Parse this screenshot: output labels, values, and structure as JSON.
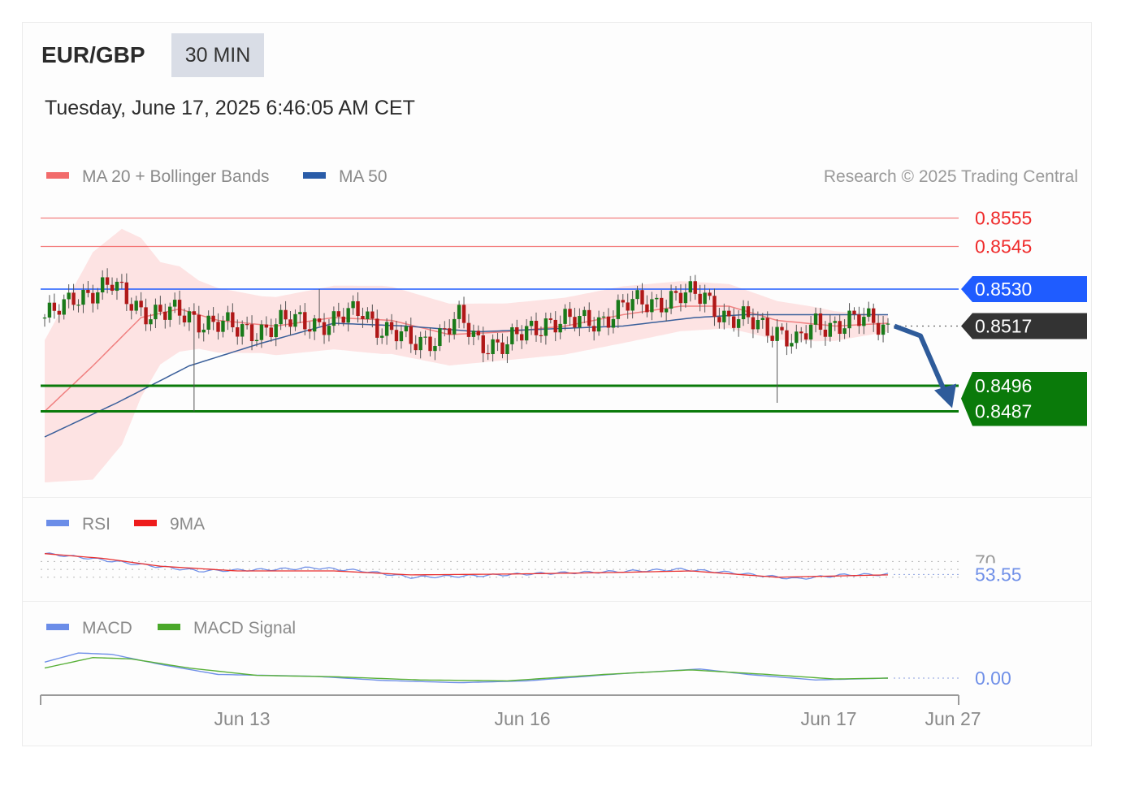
{
  "header": {
    "symbol": "EUR/GBP",
    "timeframe": "30 MIN",
    "datetime": "Tuesday, June 17, 2025 6:46:05 AM CET"
  },
  "legend_main": {
    "ma20_label": "MA 20 + Bollinger Bands",
    "ma50_label": "MA 50",
    "credit": "Research © 2025 Trading Central"
  },
  "legend_rsi": {
    "rsi_label": "RSI",
    "ma_label": "9MA"
  },
  "legend_macd": {
    "macd_label": "MACD",
    "signal_label": "MACD Signal"
  },
  "colors": {
    "resistance": "#ef2b2b",
    "pivot": "#1f5cff",
    "support": "#0a7a0a",
    "last": "#333333",
    "ma20": "#f08080",
    "ma50": "#3a5f9a",
    "band": "#fde0e0",
    "up_candle": "#1a7a1a",
    "down_candle": "#b01818",
    "arrow": "#2e5b9a",
    "rsi": "#7090e8",
    "rsi_ma": "#e83030",
    "macd": "#7090e8",
    "macd_signal": "#58b038"
  },
  "chart_data": [
    {
      "type": "candlestick",
      "instrument": "EUR/GBP",
      "interval": "30 MIN",
      "x_ticks": [
        "Jun 13",
        "Jun 16",
        "Jun 17",
        "Jun 27"
      ],
      "price_levels": [
        {
          "role": "resistance",
          "label": "0.8555",
          "value": 0.8555
        },
        {
          "role": "resistance",
          "label": "0.8545",
          "value": 0.8545
        },
        {
          "role": "pivot",
          "label": "0.8530",
          "value": 0.853
        },
        {
          "role": "last",
          "label": "0.8517",
          "value": 0.8517
        },
        {
          "role": "support",
          "label": "0.8496",
          "value": 0.8496
        },
        {
          "role": "support",
          "label": "0.8487",
          "value": 0.8487
        }
      ],
      "ylim": [
        0.8456,
        0.8566
      ],
      "forecast": "down",
      "candle_count": 176,
      "close_path": [
        {
          "i": 0,
          "v": 0.852
        },
        {
          "i": 4,
          "v": 0.8523
        },
        {
          "i": 6,
          "v": 0.8527
        },
        {
          "i": 10,
          "v": 0.853
        },
        {
          "i": 14,
          "v": 0.8531
        },
        {
          "i": 17,
          "v": 0.8526
        },
        {
          "i": 22,
          "v": 0.8522
        },
        {
          "i": 27,
          "v": 0.8521
        },
        {
          "i": 31,
          "v": 0.852
        },
        {
          "i": 36,
          "v": 0.8518
        },
        {
          "i": 40,
          "v": 0.8515
        },
        {
          "i": 44,
          "v": 0.8516
        },
        {
          "i": 50,
          "v": 0.8518
        },
        {
          "i": 55,
          "v": 0.8519
        },
        {
          "i": 60,
          "v": 0.8518
        },
        {
          "i": 66,
          "v": 0.8523
        },
        {
          "i": 70,
          "v": 0.8516
        },
        {
          "i": 76,
          "v": 0.8511
        },
        {
          "i": 82,
          "v": 0.8514
        },
        {
          "i": 86,
          "v": 0.8519
        },
        {
          "i": 90,
          "v": 0.8512
        },
        {
          "i": 96,
          "v": 0.851
        },
        {
          "i": 100,
          "v": 0.8515
        },
        {
          "i": 104,
          "v": 0.8519
        },
        {
          "i": 110,
          "v": 0.8518
        },
        {
          "i": 116,
          "v": 0.852
        },
        {
          "i": 121,
          "v": 0.8524
        },
        {
          "i": 126,
          "v": 0.8526
        },
        {
          "i": 132,
          "v": 0.8527
        },
        {
          "i": 137,
          "v": 0.8528
        },
        {
          "i": 142,
          "v": 0.8519
        },
        {
          "i": 148,
          "v": 0.8518
        },
        {
          "i": 152,
          "v": 0.8516
        },
        {
          "i": 156,
          "v": 0.851
        },
        {
          "i": 160,
          "v": 0.8518
        },
        {
          "i": 166,
          "v": 0.8518
        },
        {
          "i": 172,
          "v": 0.8519
        },
        {
          "i": 175,
          "v": 0.8517
        }
      ],
      "spikes": [
        {
          "i": 31,
          "low": 0.8487,
          "high": 0.8521
        },
        {
          "i": 57,
          "low": 0.8519,
          "high": 0.853
        },
        {
          "i": 130,
          "low": 0.8522,
          "high": 0.8531
        },
        {
          "i": 152,
          "low": 0.849,
          "high": 0.8517
        }
      ],
      "ma20": [
        {
          "i": 0,
          "v": 0.8487
        },
        {
          "i": 10,
          "v": 0.8503
        },
        {
          "i": 20,
          "v": 0.852
        },
        {
          "i": 28,
          "v": 0.8523
        },
        {
          "i": 36,
          "v": 0.8519
        },
        {
          "i": 48,
          "v": 0.8517
        },
        {
          "i": 60,
          "v": 0.852
        },
        {
          "i": 72,
          "v": 0.8519
        },
        {
          "i": 84,
          "v": 0.8514
        },
        {
          "i": 96,
          "v": 0.8515
        },
        {
          "i": 108,
          "v": 0.8517
        },
        {
          "i": 120,
          "v": 0.8521
        },
        {
          "i": 132,
          "v": 0.8524
        },
        {
          "i": 142,
          "v": 0.8524
        },
        {
          "i": 152,
          "v": 0.8519
        },
        {
          "i": 164,
          "v": 0.8517
        },
        {
          "i": 175,
          "v": 0.8518
        }
      ],
      "ma50": [
        {
          "i": 0,
          "v": 0.8478
        },
        {
          "i": 15,
          "v": 0.849
        },
        {
          "i": 30,
          "v": 0.8503
        },
        {
          "i": 45,
          "v": 0.8511
        },
        {
          "i": 60,
          "v": 0.8518
        },
        {
          "i": 75,
          "v": 0.8517
        },
        {
          "i": 90,
          "v": 0.8515
        },
        {
          "i": 105,
          "v": 0.8516
        },
        {
          "i": 120,
          "v": 0.8517
        },
        {
          "i": 135,
          "v": 0.852
        },
        {
          "i": 145,
          "v": 0.8521
        },
        {
          "i": 160,
          "v": 0.8521
        },
        {
          "i": 175,
          "v": 0.8521
        }
      ],
      "bollinger_half_width": [
        {
          "i": 0,
          "w": 0.0025
        },
        {
          "i": 10,
          "w": 0.004
        },
        {
          "i": 16,
          "w": 0.0038
        },
        {
          "i": 24,
          "w": 0.0018
        },
        {
          "i": 32,
          "w": 0.0012
        },
        {
          "i": 45,
          "w": 0.001
        },
        {
          "i": 70,
          "w": 0.0012
        },
        {
          "i": 95,
          "w": 0.001
        },
        {
          "i": 120,
          "w": 0.001
        },
        {
          "i": 140,
          "w": 0.0008
        },
        {
          "i": 160,
          "w": 0.0006
        },
        {
          "i": 175,
          "w": 0.0003
        }
      ]
    },
    {
      "type": "line",
      "name": "RSI",
      "levels": [
        70,
        50
      ],
      "last_label": "53.55",
      "ylim": [
        25,
        90
      ],
      "rsi": [
        {
          "i": 0,
          "v": 80
        },
        {
          "i": 8,
          "v": 75
        },
        {
          "i": 20,
          "v": 66
        },
        {
          "i": 32,
          "v": 58
        },
        {
          "i": 48,
          "v": 60
        },
        {
          "i": 56,
          "v": 62
        },
        {
          "i": 66,
          "v": 58
        },
        {
          "i": 76,
          "v": 50
        },
        {
          "i": 90,
          "v": 52
        },
        {
          "i": 104,
          "v": 55
        },
        {
          "i": 118,
          "v": 57
        },
        {
          "i": 132,
          "v": 60
        },
        {
          "i": 142,
          "v": 56
        },
        {
          "i": 156,
          "v": 48
        },
        {
          "i": 166,
          "v": 53
        },
        {
          "i": 175,
          "v": 53.55
        }
      ],
      "rsi_9ma": [
        {
          "i": 0,
          "v": 80
        },
        {
          "i": 12,
          "v": 74
        },
        {
          "i": 24,
          "v": 64
        },
        {
          "i": 40,
          "v": 58
        },
        {
          "i": 60,
          "v": 58
        },
        {
          "i": 76,
          "v": 53
        },
        {
          "i": 96,
          "v": 54
        },
        {
          "i": 118,
          "v": 56
        },
        {
          "i": 134,
          "v": 58
        },
        {
          "i": 152,
          "v": 50
        },
        {
          "i": 175,
          "v": 53
        }
      ]
    },
    {
      "type": "line",
      "name": "MACD",
      "last_label": "0.00",
      "ylim": [
        -0.0008,
        0.0008
      ],
      "macd": [
        {
          "i": 0,
          "v": 0.00035
        },
        {
          "i": 7,
          "v": 0.00055
        },
        {
          "i": 14,
          "v": 0.00052
        },
        {
          "i": 24,
          "v": 0.0003
        },
        {
          "i": 36,
          "v": 8e-05
        },
        {
          "i": 56,
          "v": 4e-05
        },
        {
          "i": 70,
          "v": -5e-05
        },
        {
          "i": 86,
          "v": -0.0001
        },
        {
          "i": 100,
          "v": -6e-05
        },
        {
          "i": 120,
          "v": 0.0001
        },
        {
          "i": 136,
          "v": 0.0002
        },
        {
          "i": 146,
          "v": 8e-05
        },
        {
          "i": 160,
          "v": -4e-05
        },
        {
          "i": 175,
          "v": 0.0
        }
      ],
      "signal": [
        {
          "i": 0,
          "v": 0.00022
        },
        {
          "i": 10,
          "v": 0.00045
        },
        {
          "i": 18,
          "v": 0.00042
        },
        {
          "i": 30,
          "v": 0.00022
        },
        {
          "i": 44,
          "v": 6e-05
        },
        {
          "i": 60,
          "v": 3e-05
        },
        {
          "i": 78,
          "v": -4e-05
        },
        {
          "i": 96,
          "v": -6e-05
        },
        {
          "i": 116,
          "v": 8e-05
        },
        {
          "i": 134,
          "v": 0.00018
        },
        {
          "i": 150,
          "v": 8e-05
        },
        {
          "i": 164,
          "v": -2e-05
        },
        {
          "i": 175,
          "v": 0.0
        }
      ]
    }
  ]
}
